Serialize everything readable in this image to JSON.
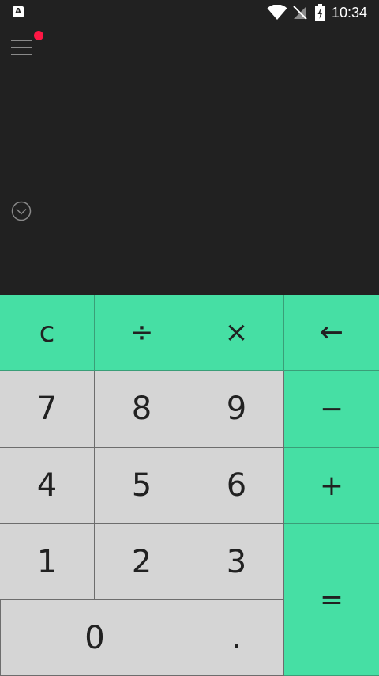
{
  "status_bar": {
    "notification_letter": "A",
    "time": "10:34",
    "icons": [
      "wifi-icon",
      "no-signal-icon",
      "battery-charging-icon"
    ]
  },
  "display": {
    "menu_icon": "hamburger-menu-icon",
    "has_notification_dot": true,
    "expand_icon": "chevron-down-circle-icon"
  },
  "keypad": {
    "clear": "c",
    "divide": "÷",
    "multiply": "×",
    "backspace": "←",
    "seven": "7",
    "eight": "8",
    "nine": "9",
    "minus": "−",
    "four": "4",
    "five": "5",
    "six": "6",
    "plus": "+",
    "one": "1",
    "two": "2",
    "three": "3",
    "equals": "=",
    "zero": "0",
    "decimal": "."
  },
  "colors": {
    "display_background": "#212121",
    "operator_key": "#46dfa4",
    "digit_key": "#d5d5d5",
    "notification_dot": "#ff1744"
  }
}
